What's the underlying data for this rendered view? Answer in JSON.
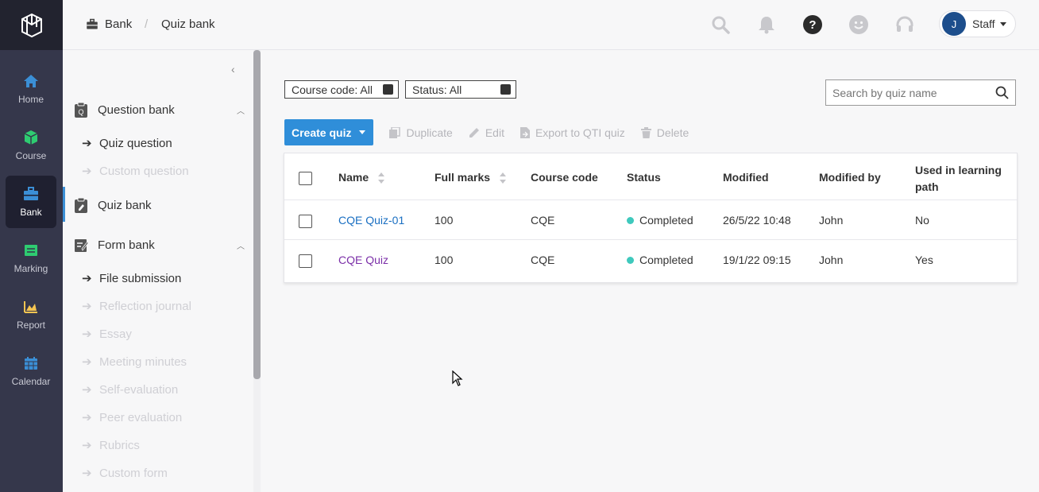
{
  "rail": {
    "items": [
      {
        "label": "Home",
        "icon": "home-icon",
        "color": "#3b8fd6"
      },
      {
        "label": "Course",
        "icon": "cube-icon",
        "color": "#2ecc71"
      },
      {
        "label": "Bank",
        "icon": "briefcase-icon",
        "color": "#3b8fd6",
        "active": true
      },
      {
        "label": "Marking",
        "icon": "marking-icon",
        "color": "#2ecc71"
      },
      {
        "label": "Report",
        "icon": "chart-area-icon",
        "color": "#f5c451"
      },
      {
        "label": "Calendar",
        "icon": "calendar-icon",
        "color": "#3b8fd6"
      }
    ]
  },
  "header": {
    "breadcrumb": {
      "root": "Bank",
      "separator": "/",
      "current": "Quiz bank"
    },
    "user": {
      "initial": "J",
      "name": "Staff"
    }
  },
  "sidebar": {
    "groups": [
      {
        "label": "Question bank",
        "items": [
          {
            "label": "Quiz question",
            "enabled": true
          },
          {
            "label": "Custom question",
            "enabled": false
          }
        ]
      },
      {
        "label": "Quiz bank",
        "active": true
      },
      {
        "label": "Form bank",
        "items": [
          {
            "label": "File submission",
            "enabled": true
          },
          {
            "label": "Reflection journal",
            "enabled": false
          },
          {
            "label": "Essay",
            "enabled": false
          },
          {
            "label": "Meeting minutes",
            "enabled": false
          },
          {
            "label": "Self-evaluation",
            "enabled": false
          },
          {
            "label": "Peer evaluation",
            "enabled": false
          },
          {
            "label": "Rubrics",
            "enabled": false
          },
          {
            "label": "Custom form",
            "enabled": false
          }
        ]
      }
    ]
  },
  "filters": {
    "course_code": "Course code: All",
    "status": "Status: All"
  },
  "search": {
    "placeholder": "Search by quiz name",
    "value": ""
  },
  "toolbar": {
    "create": "Create quiz",
    "duplicate": "Duplicate",
    "edit": "Edit",
    "export": "Export to QTI quiz",
    "delete": "Delete"
  },
  "table": {
    "columns": [
      "Name",
      "Full marks",
      "Course code",
      "Status",
      "Modified",
      "Modified by",
      "Used in learning path"
    ],
    "rows": [
      {
        "name": "CQE Quiz-01",
        "full_marks": "100",
        "course_code": "CQE",
        "status": "Completed",
        "modified": "26/5/22 10:48",
        "modified_by": "John",
        "used": "No"
      },
      {
        "name": "CQE Quiz",
        "full_marks": "100",
        "course_code": "CQE",
        "status": "Completed",
        "modified": "19/1/22 09:15",
        "modified_by": "John",
        "used": "Yes"
      }
    ]
  },
  "colors": {
    "primary": "#2f8ed9",
    "status_completed": "#3fc9bd",
    "link": "#1a6fc2",
    "link_visited": "#7b2fa8",
    "rail_bg": "#35374b"
  }
}
